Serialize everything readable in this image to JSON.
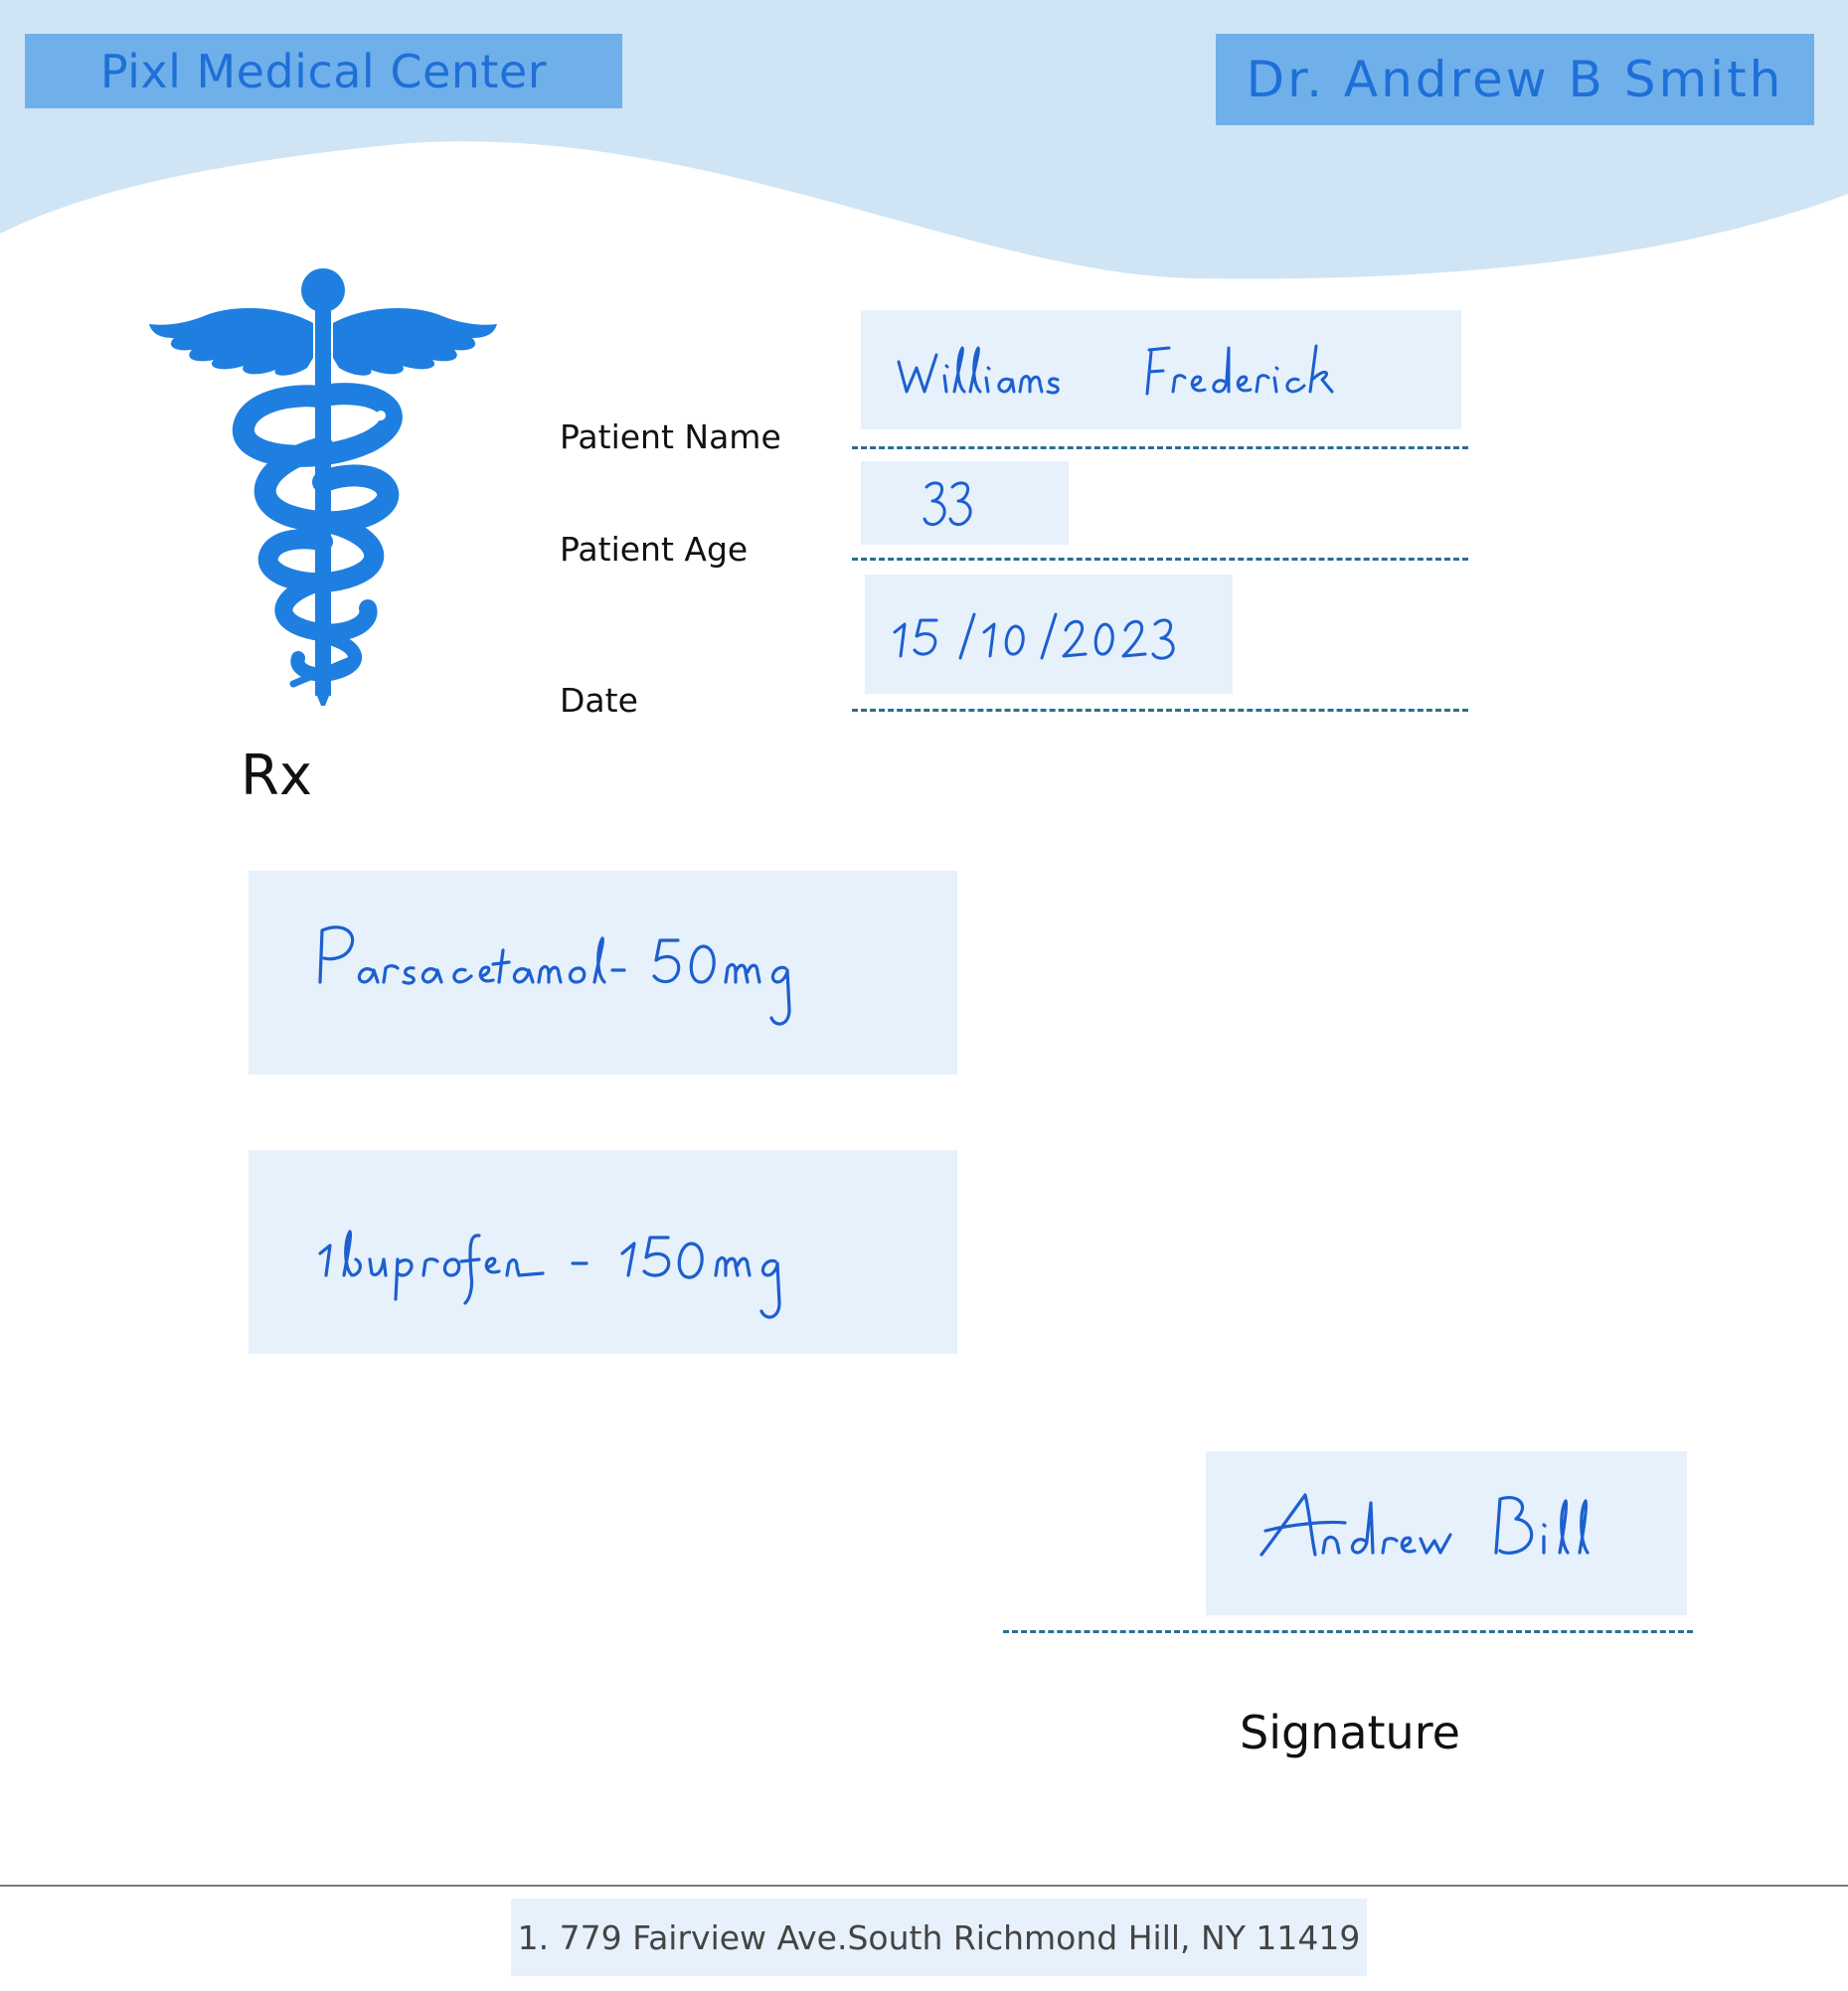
{
  "header": {
    "clinic_name": "Pixl Medical Center",
    "doctor_name": "Dr. Andrew B Smith"
  },
  "logo": {
    "icon": "caduceus-icon",
    "color": "#1f7fe0"
  },
  "patient": {
    "name_label": "Patient Name",
    "name_value": "Williams Frederick",
    "age_label": "Patient Age",
    "age_value": "33",
    "date_label": "Date",
    "date_value": "15/10/2023"
  },
  "rx_label": "Rx",
  "prescriptions": [
    {
      "text": "Paracetamol- 50mg"
    },
    {
      "text": "Ibuprofen - 150mg"
    }
  ],
  "signature": {
    "value": "Andrew Bill",
    "label": "Signature"
  },
  "footer": {
    "address": "1. 779 Fairview Ave.South Richmond Hill, NY 11419"
  },
  "colors": {
    "header_bg": "#cfe4f4",
    "label_box": "#6fb0ea",
    "accent_text": "#1f6fd8",
    "ink": "#1d5fcf",
    "field_bg": "#e6f1fc",
    "dotted_line": "#2a6e93"
  }
}
